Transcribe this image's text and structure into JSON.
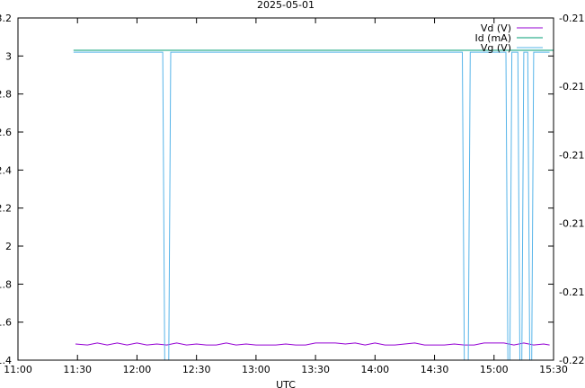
{
  "chart_data": {
    "type": "line",
    "title": "2025-05-01",
    "xlabel": "UTC",
    "ylabel": "",
    "y2label": "",
    "x_ticks": [
      "11:00",
      "11:30",
      "12:00",
      "12:30",
      "13:00",
      "13:30",
      "14:00",
      "14:30",
      "15:00",
      "15:30"
    ],
    "x_range": [
      "11:00",
      "15:30"
    ],
    "ylim": [
      1.4,
      3.2
    ],
    "y_ticks": [
      "1.4",
      "1.6",
      "1.8",
      "2",
      "2.2",
      "2.4",
      "2.6",
      "2.8",
      "3",
      "3.2"
    ],
    "y2lim": [
      -0.22,
      -0.21
    ],
    "y2_ticks": [
      "-0.22",
      "-0.218",
      "-0.216",
      "-0.214",
      "-0.212",
      "-0.21"
    ],
    "legend_position": "top-right",
    "grid": false,
    "series": [
      {
        "name": "Vd (V)",
        "axis": "left",
        "color": "#9400d3",
        "x": [
          "11:29",
          "11:35",
          "11:40",
          "11:45",
          "11:50",
          "11:55",
          "12:00",
          "12:05",
          "12:10",
          "12:15",
          "12:20",
          "12:25",
          "12:30",
          "12:35",
          "12:40",
          "12:45",
          "12:50",
          "12:55",
          "13:00",
          "13:05",
          "13:10",
          "13:15",
          "13:20",
          "13:25",
          "13:30",
          "13:35",
          "13:40",
          "13:45",
          "13:50",
          "13:55",
          "14:00",
          "14:05",
          "14:10",
          "14:15",
          "14:20",
          "14:25",
          "14:30",
          "14:35",
          "14:40",
          "14:45",
          "14:50",
          "14:55",
          "15:00",
          "15:05",
          "15:10",
          "15:15",
          "15:20",
          "15:25",
          "15:28"
        ],
        "values": [
          1.485,
          1.48,
          1.49,
          1.48,
          1.49,
          1.48,
          1.49,
          1.48,
          1.485,
          1.48,
          1.49,
          1.48,
          1.485,
          1.48,
          1.48,
          1.49,
          1.48,
          1.485,
          1.48,
          1.48,
          1.48,
          1.485,
          1.48,
          1.48,
          1.49,
          1.49,
          1.49,
          1.485,
          1.49,
          1.48,
          1.49,
          1.48,
          1.48,
          1.485,
          1.49,
          1.48,
          1.48,
          1.48,
          1.485,
          1.48,
          1.48,
          1.49,
          1.49,
          1.49,
          1.48,
          1.49,
          1.48,
          1.485,
          1.48
        ]
      },
      {
        "name": "Id (mA)",
        "axis": "left",
        "color": "#009e73",
        "x": [
          "11:28",
          "15:30"
        ],
        "values": [
          3.03,
          3.03
        ]
      },
      {
        "name": "Vg (V)",
        "axis": "right",
        "color": "#56b4e9",
        "x": [
          "11:28",
          "12:13",
          "12:14",
          "12:16",
          "12:17",
          "14:44",
          "14:45",
          "14:47",
          "14:48",
          "15:06",
          "15:07",
          "15:08",
          "15:09",
          "15:12",
          "15:13",
          "15:14",
          "15:15",
          "15:17",
          "15:18",
          "15:19",
          "15:20",
          "15:28"
        ],
        "values": [
          -0.211,
          -0.211,
          -0.22,
          -0.22,
          -0.211,
          -0.211,
          -0.22,
          -0.22,
          -0.211,
          -0.211,
          -0.22,
          -0.22,
          -0.211,
          -0.211,
          -0.22,
          -0.22,
          -0.211,
          -0.211,
          -0.22,
          -0.22,
          -0.211,
          -0.211
        ]
      }
    ]
  }
}
